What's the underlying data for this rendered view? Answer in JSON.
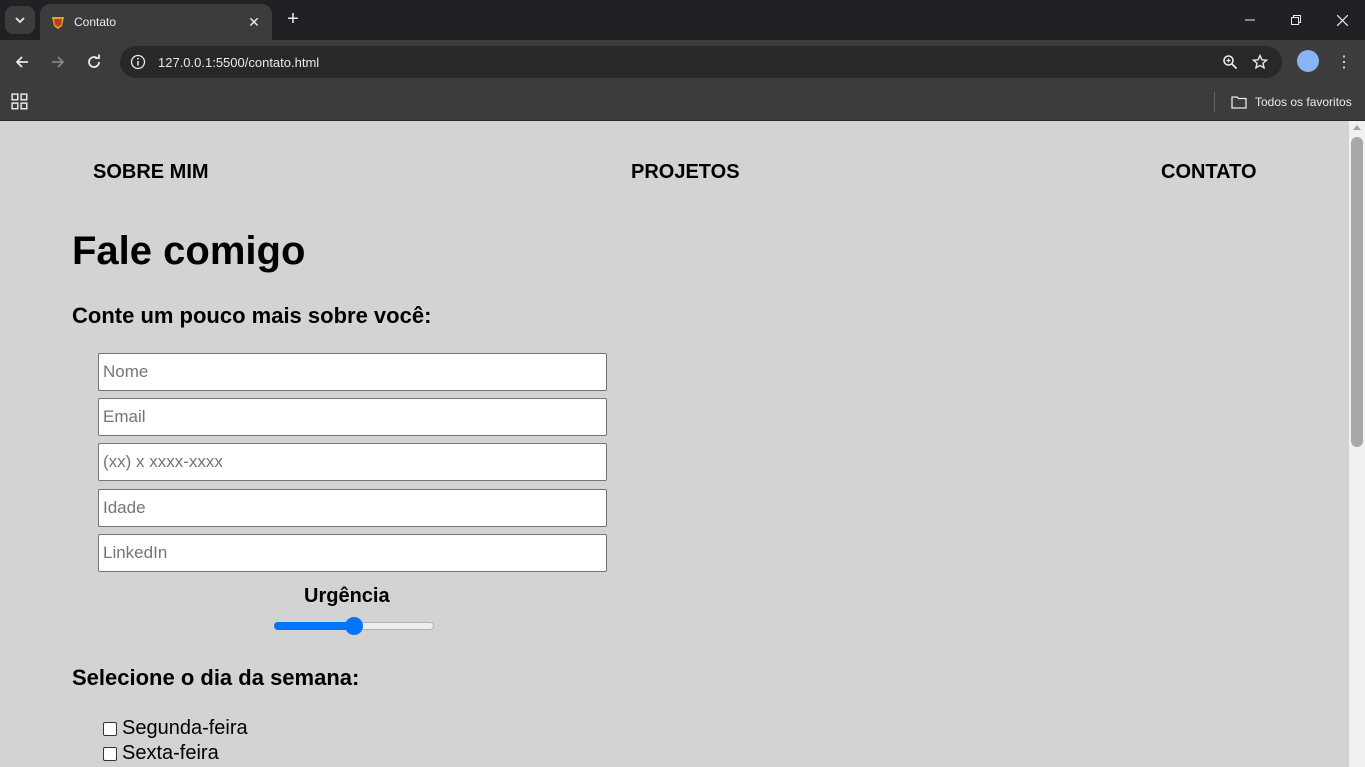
{
  "browser": {
    "tab_title": "Contato",
    "url_host": "127.0.0.1",
    "url_path": ":5500/contato.html",
    "bookmark_folder": "Todos os favoritos"
  },
  "site": {
    "nav": [
      "SOBRE MIM",
      "PROJETOS",
      "CONTATO"
    ],
    "title": "Fale comigo",
    "subtitle": "Conte um pouco mais sobre você:",
    "fields": [
      {
        "placeholder": "Nome",
        "value": ""
      },
      {
        "placeholder": "Email",
        "value": ""
      },
      {
        "placeholder": "(xx) x xxxx-xxxx",
        "value": ""
      },
      {
        "placeholder": "Idade",
        "value": ""
      },
      {
        "placeholder": "LinkedIn",
        "value": ""
      }
    ],
    "urgency_label": "Urgência",
    "urgency_value": 0.5,
    "day_title": "Selecione o dia da semana:",
    "days": [
      {
        "label": "Segunda-feira",
        "checked": false
      },
      {
        "label": "Sexta-feira",
        "checked": false
      }
    ]
  },
  "colors": {
    "page_bg": "#d3d3d3",
    "accent": "#0075ff",
    "chrome_dark": "#202124",
    "chrome_toolbar": "#3c3c3c"
  }
}
